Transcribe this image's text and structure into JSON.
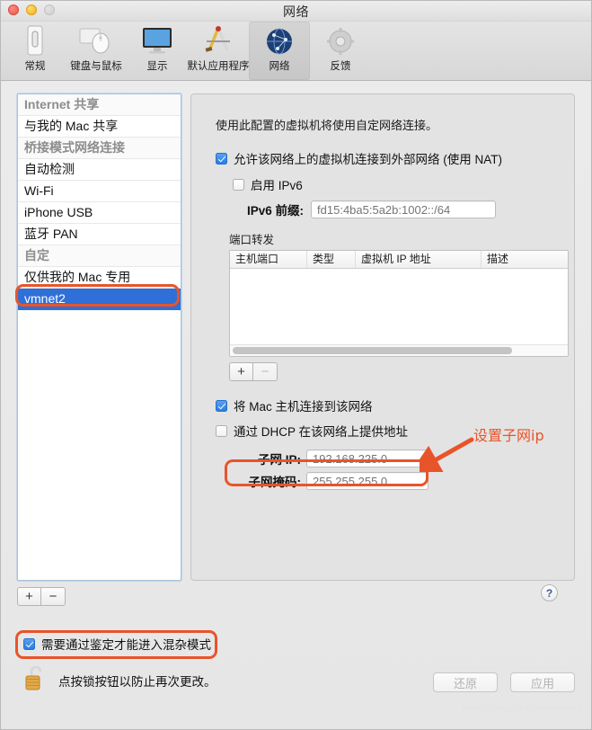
{
  "window": {
    "title": "网络",
    "traffic_lights": [
      "close",
      "minimize",
      "zoom"
    ]
  },
  "toolbar": {
    "items": [
      {
        "label": "常规",
        "icon": "general-device-icon",
        "selected": false
      },
      {
        "label": "键盘与鼠标",
        "icon": "keyboard-mouse-icon",
        "selected": false
      },
      {
        "label": "显示",
        "icon": "display-monitor-icon",
        "selected": false
      },
      {
        "label": "默认应用程序",
        "icon": "default-applications-icon",
        "selected": false
      },
      {
        "label": "网络",
        "icon": "network-globe-icon",
        "selected": true
      },
      {
        "label": "反馈",
        "icon": "feedback-gear-icon",
        "selected": false
      }
    ]
  },
  "sidebar": {
    "items": [
      {
        "label": "Internet 共享",
        "type": "header",
        "selected": false
      },
      {
        "label": "与我的 Mac 共享",
        "type": "item",
        "selected": false
      },
      {
        "label": "桥接模式网络连接",
        "type": "header",
        "selected": false
      },
      {
        "label": "自动检测",
        "type": "item",
        "selected": false
      },
      {
        "label": "Wi-Fi",
        "type": "item",
        "selected": false
      },
      {
        "label": "iPhone USB",
        "type": "item",
        "selected": false
      },
      {
        "label": "蓝牙 PAN",
        "type": "item",
        "selected": false
      },
      {
        "label": "自定",
        "type": "header",
        "selected": false
      },
      {
        "label": "仅供我的 Mac 专用",
        "type": "item",
        "selected": false
      },
      {
        "label": "vmnet2",
        "type": "item",
        "selected": true
      }
    ],
    "add_button": "+",
    "remove_button": "−"
  },
  "panel": {
    "description": "使用此配置的虚拟机将使用自定网络连接。",
    "nat_checkbox": {
      "label": "允许该网络上的虚拟机连接到外部网络 (使用 NAT)",
      "checked": true
    },
    "ipv6_checkbox": {
      "label": "启用 IPv6",
      "checked": false
    },
    "ipv6_prefix": {
      "label": "IPv6 前缀:",
      "placeholder": "fd15:4ba5:5a2b:1002::/64",
      "value": ""
    },
    "port_forwarding": {
      "section_label": "端口转发",
      "columns": [
        "主机端口",
        "类型",
        "虚拟机 IP 地址",
        "描述"
      ],
      "rows": [],
      "add_button": "+",
      "remove_button": "−"
    },
    "host_connect_checkbox": {
      "label": "将 Mac 主机连接到该网络",
      "checked": true
    },
    "dhcp_checkbox": {
      "label": "通过 DHCP 在该网络上提供地址",
      "checked": false
    },
    "subnet_ip": {
      "label": "子网 IP:",
      "placeholder": "192.168.225.0",
      "value": ""
    },
    "subnet_mask": {
      "label": "子网掩码:",
      "placeholder": "255.255.255.0",
      "value": ""
    },
    "help_button": "?"
  },
  "bottom": {
    "promisc_checkbox": {
      "label": "需要通过鉴定才能进入混杂模式",
      "checked": true
    },
    "lock_icon": "unlocked-padlock-icon",
    "lock_text": "点按锁按钮以防止再次更改。",
    "restore_button": "还原",
    "apply_button": "应用",
    "watermark": "https://blog.csdn.net/Mrdou"
  },
  "annotations": {
    "accent_color": "#e8542a",
    "subnet_note": "设置子网ip"
  }
}
